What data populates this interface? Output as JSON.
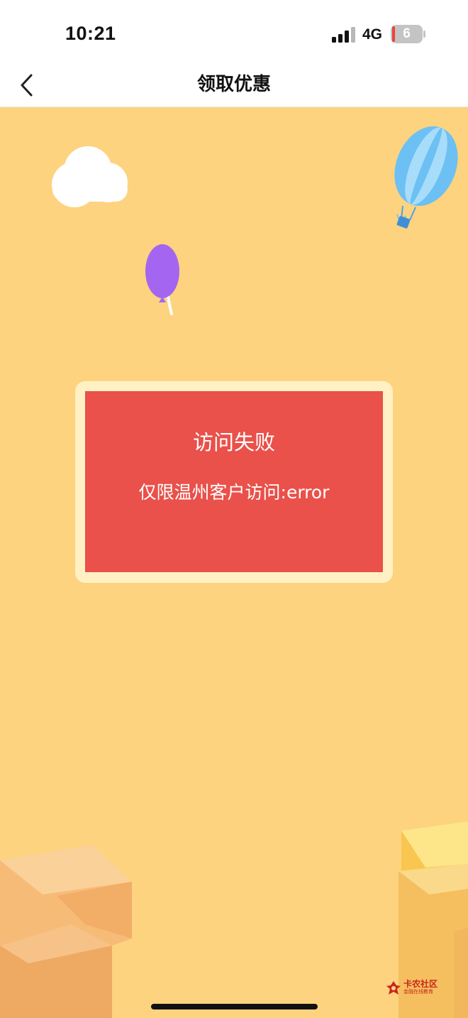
{
  "status_bar": {
    "time": "10:21",
    "network": "4G",
    "battery_level": "6",
    "icons": [
      "signal-icon",
      "battery-icon"
    ]
  },
  "nav": {
    "title": "领取优惠",
    "back_icon": "chevron-left-icon"
  },
  "error_dialog": {
    "title": "访问失败",
    "message": "仅限温州客户访问:error"
  },
  "watermark": {
    "name": "卡农社区",
    "subtitle": "金融在线教育"
  },
  "colors": {
    "background": "#fdd37f",
    "card_border": "#fff1c4",
    "card_fill": "#e9514a",
    "text_on_card": "#ffffff",
    "nav_background": "#ffffff"
  },
  "decorations": [
    "cloud-icon",
    "hot-air-balloon-icon",
    "purple-balloon-icon",
    "blocks-left",
    "blocks-right"
  ]
}
